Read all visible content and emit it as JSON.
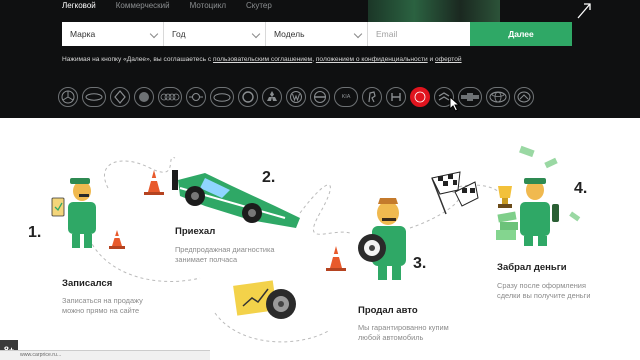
{
  "tabs": [
    {
      "label": "Легковой"
    },
    {
      "label": "Коммерческий"
    },
    {
      "label": "Мотоцикл"
    },
    {
      "label": "Скутер"
    }
  ],
  "form": {
    "brand_label": "Марка",
    "year_label": "Год",
    "model_label": "Модель",
    "email_placeholder": "Email",
    "next_label": "Далее"
  },
  "consent": {
    "prefix": "Нажимая на кнопку «Далее», вы соглашаетесь с ",
    "link1": "пользовательским соглашением",
    "sep1": ", ",
    "link2": "положением о конфиденциальности",
    "sep2": " и ",
    "link3": "офертой"
  },
  "brands": [
    "mercedes",
    "bmw-mini",
    "renault",
    "chevrolet-old",
    "audi",
    "mini",
    "ford",
    "skoda",
    "mitsubishi",
    "volkswagen",
    "opel",
    "kia",
    "peugeot",
    "honda",
    "lexus",
    "citroen",
    "chevrolet",
    "toyota",
    "mazda"
  ],
  "brand_texts": [
    "",
    "",
    "",
    "",
    "",
    "",
    "",
    "",
    "",
    "",
    "",
    "KIA",
    "",
    "",
    "",
    "",
    "",
    "",
    ""
  ],
  "steps": [
    {
      "num": "1.",
      "title": "Записался",
      "desc1": "Записаться на продажу",
      "desc2": "можно прямо на сайте"
    },
    {
      "num": "2.",
      "title": "Приехал",
      "desc1": "Предпродажная диагностика",
      "desc2": "занимает полчаса"
    },
    {
      "num": "3.",
      "title": "Продал авто",
      "desc1": "Мы гарантированно купим",
      "desc2": "любой автомобиль"
    },
    {
      "num": "4.",
      "title": "Забрал деньги",
      "desc1": "Сразу после оформления",
      "desc2": "сделки вы получите деньги"
    }
  ],
  "status_text": "www.carprice.ru...",
  "gplus_label": "8+",
  "colors": {
    "accent": "#2fa866",
    "hero_bg": "#0f1011",
    "brand_highlight": "#e0141e"
  }
}
